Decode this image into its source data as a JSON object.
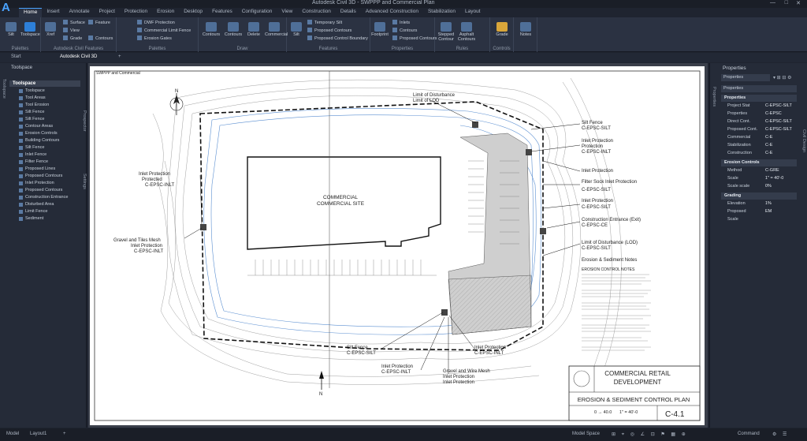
{
  "app": {
    "title": "Autodesk Civil 3D - SWPPP and Commercial Plan",
    "logo": "A",
    "window_controls": [
      "—",
      "□",
      "✕"
    ]
  },
  "menu_tabs": [
    "Home",
    "Insert",
    "Annotate",
    "Project",
    "Protection",
    "Erosion",
    "Desktop",
    "Features",
    "Configuration",
    "View",
    "Construction",
    "Details",
    "Advanced Construction",
    "Stabilization",
    "Layout"
  ],
  "ribbon": {
    "groups": [
      {
        "label": "Palettes",
        "buttons": [
          "Silt",
          "Toolspace"
        ]
      },
      {
        "label": "Autodesk Civil Features",
        "buttons": [
          "Xref",
          "Surface",
          "Feature",
          "View",
          "Grade",
          "Contours"
        ]
      },
      {
        "label": "Palettes",
        "buttons": [
          "DWF Protection",
          "Commercial Limit Fence",
          "Erosion Gates"
        ]
      },
      {
        "label": "Draw",
        "buttons": [
          "Contours",
          "Contours",
          "Delete",
          "Commercial"
        ]
      },
      {
        "label": "Features",
        "buttons": [
          "Silt",
          "Temporary Silt",
          "Proposed Contours",
          "Proposed Control Boundary"
        ]
      },
      {
        "label": "Properties",
        "buttons": [
          "Footprint",
          "Inlets",
          "Contours",
          "Proposed Contours"
        ]
      },
      {
        "label": "Rules",
        "buttons": [
          "Stepped Contour",
          "Asphalt Contours",
          "Erosion"
        ]
      },
      {
        "label": "Controls",
        "buttons": [
          "Grade"
        ]
      },
      {
        "label": "",
        "buttons": [
          "Notes"
        ]
      }
    ]
  },
  "doc_tabs": [
    "Start",
    "Autodesk Civil 3D",
    "+"
  ],
  "toolspace": {
    "title": "Toolspace",
    "side_tabs": [
      "Toolspace",
      "Prospector",
      "Settings"
    ],
    "tree_header": "Toolspace",
    "items": [
      "Toolspace",
      "Tool Areas",
      "Tool Erosion",
      "Silt Fence",
      "Silt Fence",
      "Contour Areas",
      "Erosion Controls",
      "Building Contours",
      "Silt Fence",
      "Inlet Fence",
      "Filter Fence",
      "Proposed Lines",
      "Proposed Contours",
      "Inlet Protection",
      "Proposed Contours",
      "Construction Entrance",
      "Disturbed Area",
      "Limit Fence",
      "Sediment"
    ]
  },
  "drawing": {
    "sheet_tag": "SWPPP and Commercial",
    "north_label": "N",
    "building_label_1": "COMMERCIAL",
    "building_label_2": "COMMERCIAL SITE",
    "callouts": {
      "lod_top_1": "Limit of Disturbance",
      "lod_top_2": "Limit of LOD",
      "inlet_left_1": "Inlet Protection",
      "inlet_left_2": "Protected",
      "inlet_left_3": "C-EPSC-INLT",
      "gravel_left_1": "Gravel and Tiles Mesh",
      "gravel_left_2": "Inlet Protection",
      "gravel_left_3": "C-EPSC-INLT",
      "silt_r1_1": "Silt Fence",
      "silt_r1_2": "C-EPSC-SILT",
      "inlet_r1_1": "Inlet Protection",
      "inlet_r1_2": "Protection",
      "inlet_r1_3": "C-EPSC-INLT",
      "inlet_r2": "Inlet Protection",
      "filter_r_1": "Filter Sock Inlet Protection",
      "filter_r_2": "C-EPSC-SILT",
      "inlet_r3_1": "Inlet Protection",
      "inlet_r3_2": "C-EPSC-SILT",
      "ce_r_1": "Construction Entrance (Exit)",
      "ce_r_2": "C-EPSC-CE",
      "lod_r_1": "Limit of Disturbance (LOD)",
      "lod_r_2": "C-EPSC-SILT",
      "notes_title": "Erosion & Sediment Notes",
      "notes_sub": "EROSION CONTROL NOTES",
      "silt_b_1": "Silt Fence",
      "silt_b_2": "C-EPSC-SILT",
      "inlet_b_1": "Inlet Protection",
      "inlet_b_2": "C-EPSC-INLT",
      "gravel_b_1": "Gravel and Wire Mesh",
      "gravel_b_2": "Inlet Protection",
      "gravel_b_3": "Inlet Protection",
      "inlet_b2_1": "Inlet Protection",
      "inlet_b2_2": "C-EPSC-INLT",
      "north_bottom": "N"
    },
    "title_block": {
      "project_1": "COMMERCIAL RETAIL",
      "project_2": "DEVELOPMENT",
      "sheet_title": "EROSION & SEDIMENT CONTROL PLAN",
      "scale": "1\" = 40'-0",
      "sheet_no": "C-4.1",
      "drawn_no": "0 → 40.0"
    }
  },
  "properties": {
    "title": "Properties",
    "side_tabs": [
      "Properties",
      "Civil Design"
    ],
    "dropdown_1": "Properties",
    "dropdown_2": "Properties",
    "section_1": "Properties",
    "rows_1": [
      {
        "k": "Project Stat",
        "v": "C-EPSC-SILT"
      },
      {
        "k": "Properties",
        "v": "C-EPSC"
      },
      {
        "k": "Direct Cont.",
        "v": "C-EPSC-SILT"
      },
      {
        "k": "Proposed Cont.",
        "v": "C-EPSC-SILT"
      },
      {
        "k": "Commercial",
        "v": "C-E"
      },
      {
        "k": "Stabilization",
        "v": "C-E"
      },
      {
        "k": "Construction",
        "v": "C-E"
      }
    ],
    "section_2": "Erosion Controls",
    "rows_2": [
      {
        "k": "Method",
        "v": "C-GRE"
      },
      {
        "k": "Scale",
        "v": "1\" = 40'-0"
      },
      {
        "k": "Scale scale",
        "v": "0%"
      }
    ],
    "section_3": "Grading",
    "rows_3": [
      {
        "k": "Elevation",
        "v": "1%"
      },
      {
        "k": "Proposed",
        "v": "EM"
      },
      {
        "k": "Scale",
        "v": ""
      }
    ]
  },
  "status": {
    "left_tabs": [
      "Model",
      "Layout1",
      "+"
    ],
    "model_space": "Model Space",
    "command": "Command"
  }
}
